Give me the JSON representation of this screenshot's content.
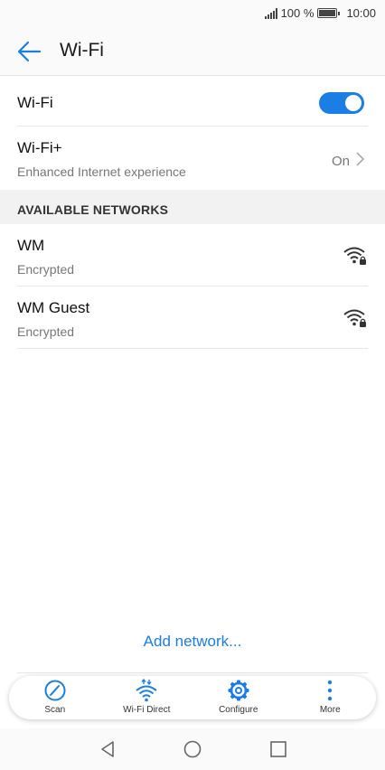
{
  "status_bar": {
    "battery_text": "100 %",
    "time": "10:00"
  },
  "header": {
    "title": "Wi-Fi"
  },
  "wifi_toggle": {
    "label": "Wi-Fi",
    "enabled": true
  },
  "wifi_plus": {
    "label": "Wi-Fi+",
    "subtitle": "Enhanced Internet experience",
    "value": "On"
  },
  "section_header": "AVAILABLE NETWORKS",
  "networks": [
    {
      "name": "WM",
      "status": "Encrypted"
    },
    {
      "name": "WM Guest",
      "status": "Encrypted"
    }
  ],
  "add_network": "Add network...",
  "actions": [
    {
      "label": "Scan",
      "icon": "scan-icon"
    },
    {
      "label": "Wi-Fi Direct",
      "icon": "wifi-direct-icon"
    },
    {
      "label": "Configure",
      "icon": "gear-icon"
    },
    {
      "label": "More",
      "icon": "more-vertical-icon"
    }
  ],
  "colors": {
    "accent": "#1a7ee5",
    "toggle_on": "#1a7ee5",
    "section_bg": "#f2f2f2"
  }
}
